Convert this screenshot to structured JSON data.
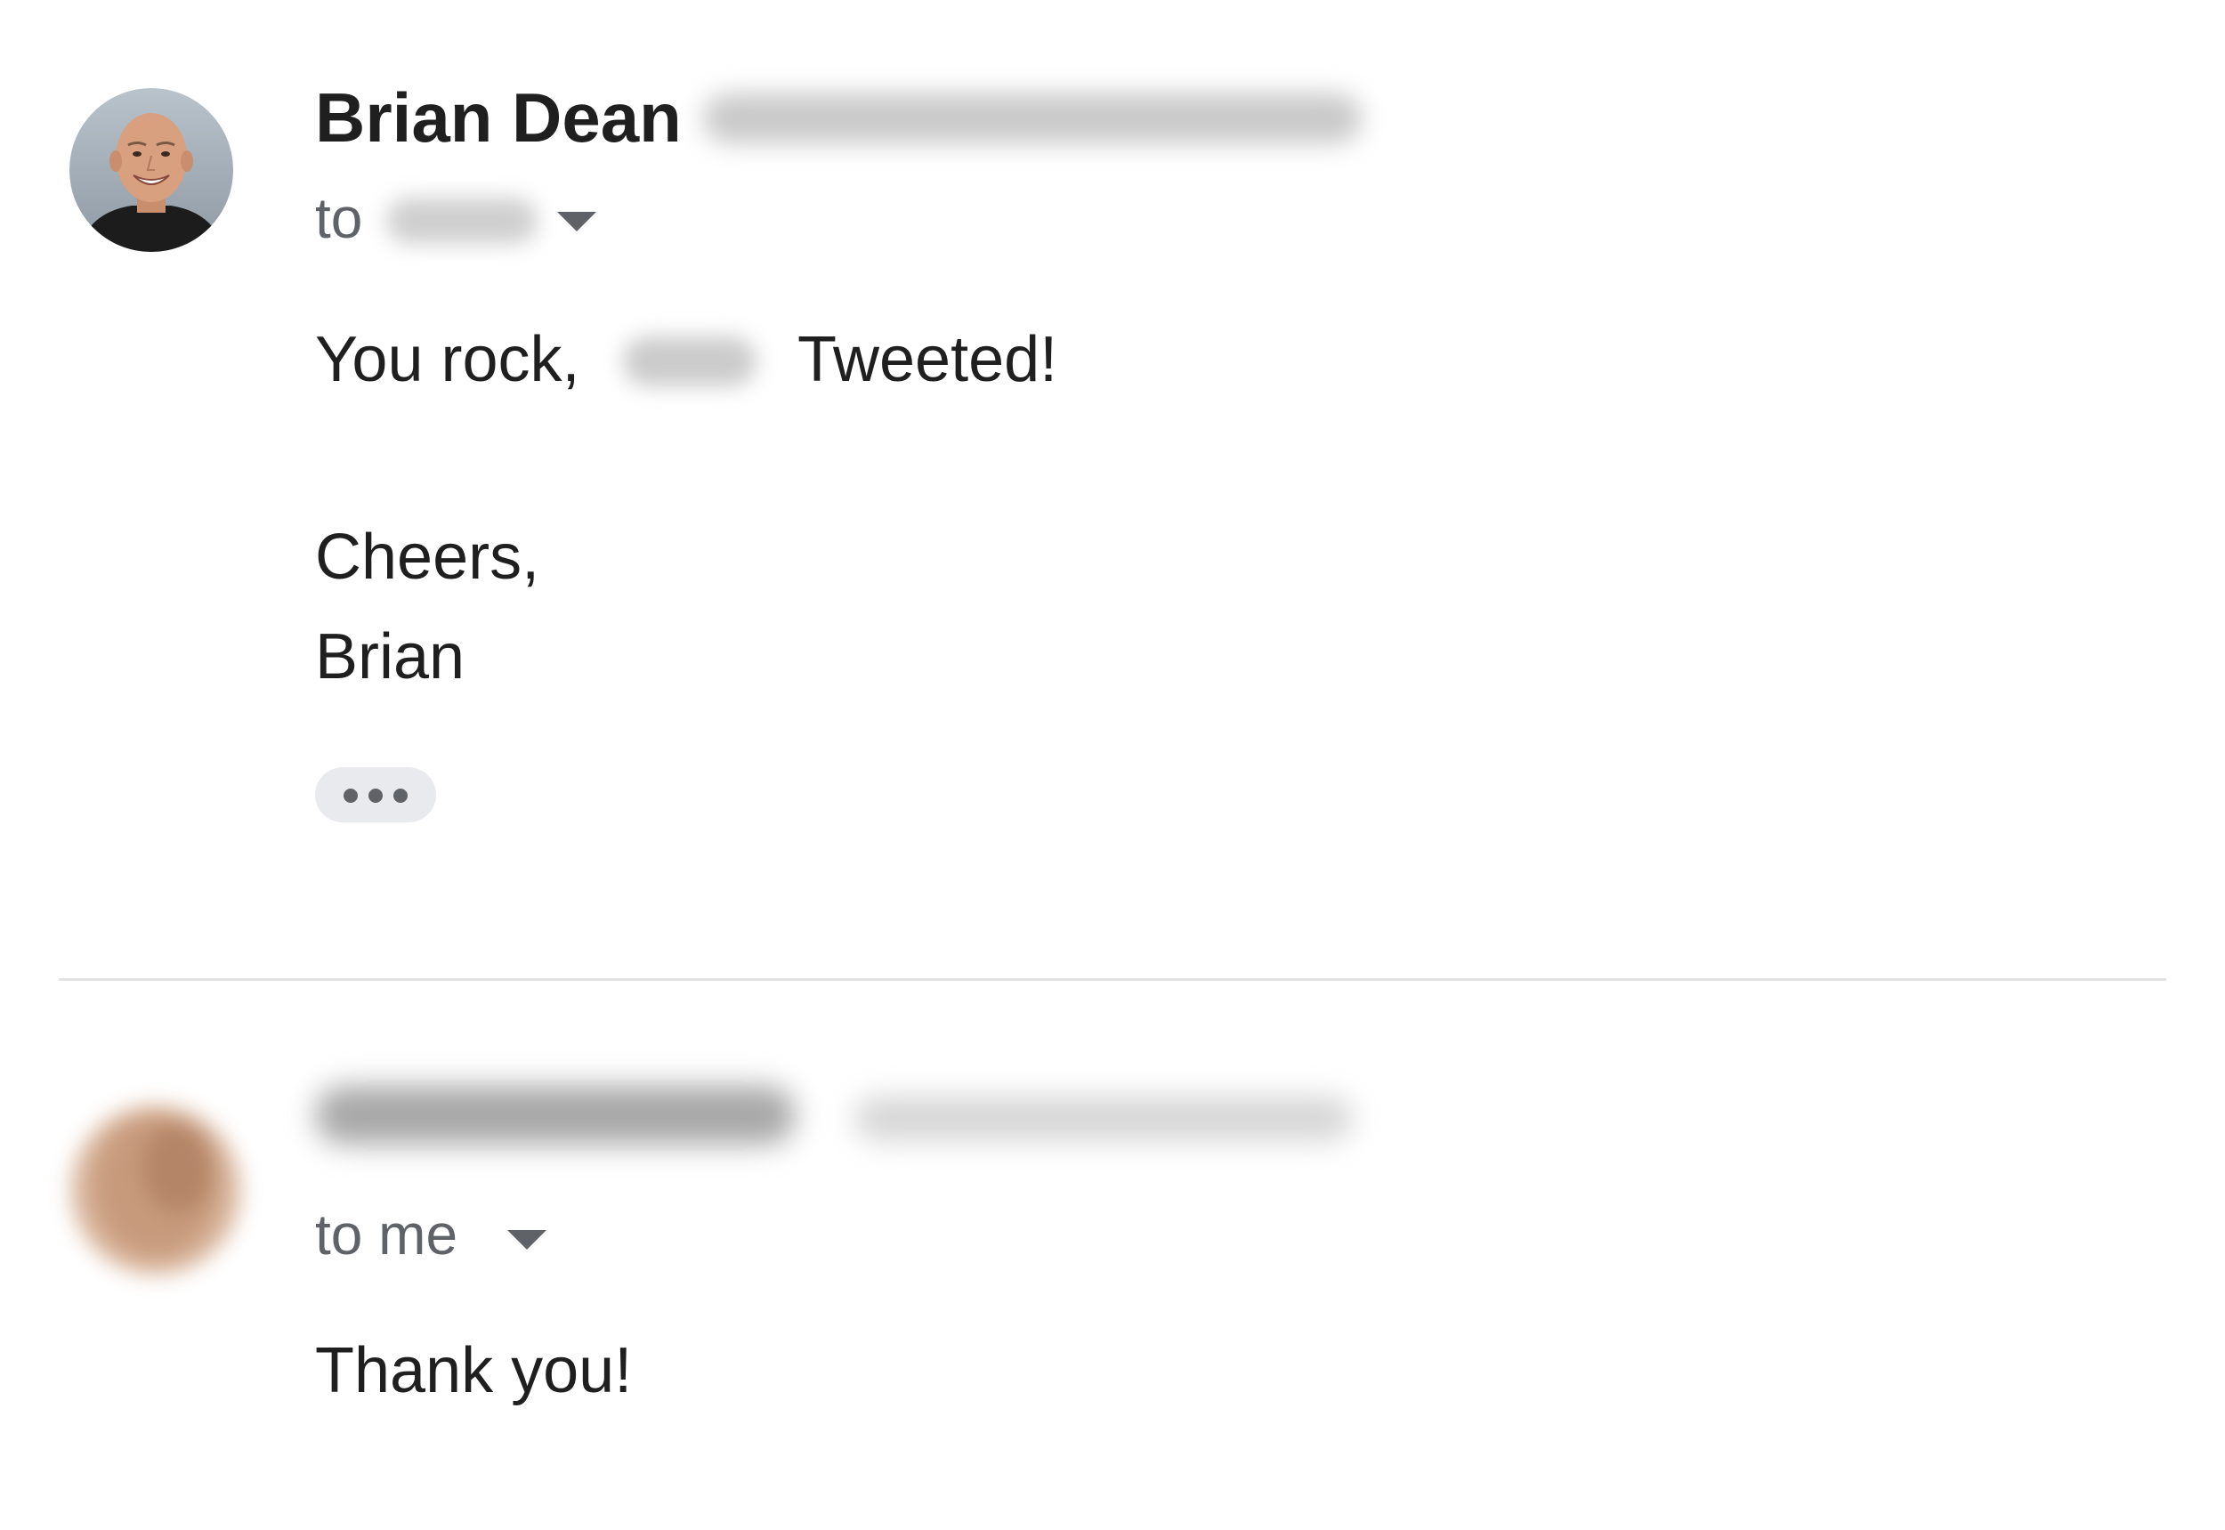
{
  "messages": [
    {
      "sender_name": "Brian Dean",
      "to_label": "to",
      "body": {
        "greeting_before": "You rock,",
        "greeting_after": "Tweeted!",
        "signoff": "Cheers,",
        "signature": "Brian"
      },
      "avatar_icon": "avatar-photo",
      "expand_icon": "chevron-down-icon",
      "more_icon": "ellipsis-icon"
    },
    {
      "to_label": "to me",
      "body": {
        "text": "Thank you!"
      },
      "avatar_icon": "avatar-photo",
      "expand_icon": "chevron-down-icon"
    }
  ],
  "colors": {
    "text_primary": "#1f1f1f",
    "text_secondary": "#5f6368",
    "divider": "#e3e3e3",
    "chip_bg": "#e8eaed"
  }
}
